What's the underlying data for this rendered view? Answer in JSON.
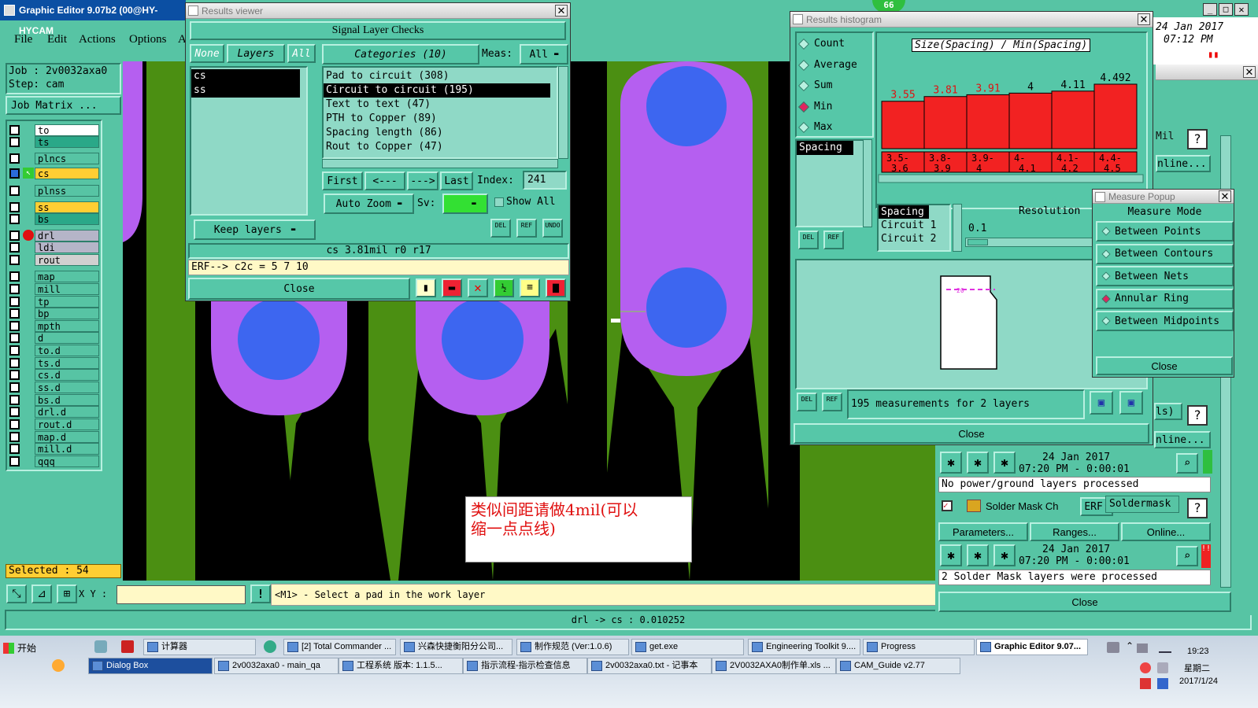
{
  "main": {
    "title": "Graphic Editor 9.07b2 (00@HY-HYCAM",
    "menu": [
      "File",
      "Edit",
      "Actions",
      "Options",
      "A"
    ],
    "job_label": "Job : 2v0032axa0",
    "step_label": "Step: cam",
    "job_matrix": "Job Matrix ...",
    "layers": [
      "to",
      "ts",
      "plncs",
      "cs",
      "plnss",
      "ss",
      "bs",
      "drl",
      "ldi",
      "rout",
      "map",
      "mill",
      "tp",
      "bp",
      "mpth",
      "d",
      "to.d",
      "ts.d",
      "cs.d",
      "ss.d",
      "bs.d",
      "drl.d",
      "rout.d",
      "map.d",
      "mill.d",
      "qqq"
    ],
    "selected": "Selected : 54",
    "xy_label": "X Y :",
    "prompt": "<M1> - Select a pad in the work layer",
    "status": "drl -> cs : 0.010252"
  },
  "results_viewer": {
    "title": "Results viewer",
    "header": "Signal Layer Checks",
    "none": "None",
    "layers_btn": "Layers",
    "all": "All",
    "categories": "Categories (10)",
    "meas": "Meas:",
    "meas_value": "All",
    "layer_list": [
      "cs",
      "ss"
    ],
    "category_list": [
      "Pad to circuit (308)",
      "Circuit to circuit (195)",
      "Text to text (47)",
      "PTH to Copper (89)",
      "Spacing length (86)",
      "Rout to Copper (47)"
    ],
    "first": "First",
    "prev": "<---",
    "next": "--->",
    "last": "Last",
    "index_label": "Index:",
    "index_value": "241",
    "keep_layers": "Keep layers",
    "auto_zoom": "Auto Zoom",
    "sv": "Sv:",
    "show_all": "Show All",
    "del": "DEL",
    "ref": "REF",
    "undo": "UNDO",
    "info_line": "cs 3.81mil  r0  r17",
    "erf_line": "ERF--> c2c = 5 7 10",
    "close": "Close"
  },
  "histogram": {
    "title": "Results histogram",
    "options": [
      "Count",
      "Average",
      "Sum",
      "Min",
      "Max"
    ],
    "selected_option": "Min",
    "chart_title": "Size(Spacing) / Min(Spacing)",
    "list_top": [
      "Spacing"
    ],
    "list_bottom": [
      "Spacing",
      "Circuit 1",
      "Circuit 2"
    ],
    "resolution_label": "Resolution",
    "resolution_value": "0.1",
    "summary": "195 measurements for 2 layers",
    "close": "Close"
  },
  "chart_data": {
    "type": "bar",
    "title": "Size(Spacing) / Min(Spacing)",
    "categories": [
      "3.5-3.6",
      "3.8-3.9",
      "3.9-4",
      "4-4.1",
      "4.1-4.2",
      "4.4-4.5"
    ],
    "values": [
      3.55,
      3.81,
      3.91,
      4,
      4.11,
      4.492
    ],
    "value_labels": [
      "3.55",
      "3.81",
      "3.91",
      "4",
      "4.11",
      "4.492"
    ],
    "bar_color": "#f22222"
  },
  "measure_popup": {
    "title": "Measure Popup",
    "header": "Measure Mode",
    "modes": [
      "Between Points",
      "Between Contours",
      "Between Nets",
      "Annular Ring",
      "Between Midpoints"
    ],
    "selected_mode": "Annular Ring",
    "close": "Close"
  },
  "right_panel": {
    "date_top": "24 Jan 2017",
    "time_top": "07:12 PM",
    "mil": "Mil",
    "online1": "nline...",
    "ls": "ls)",
    "online2": "nline...",
    "date1": "24 Jan 2017",
    "time1": "07:20 PM - 0:00:01",
    "msg1": "No power/ground layers processed",
    "solder_mask": "Solder Mask Ch",
    "erf": "ERF:",
    "soldermask": "Soldermask",
    "parameters": "Parameters...",
    "ranges": "Ranges...",
    "online3": "Online...",
    "date2": "24 Jan 2017",
    "time2": "07:20 PM - 0:00:01",
    "msg2": "2 Solder Mask layers were processed",
    "close": "Close"
  },
  "annotation": {
    "line1": "类似间距请做4mil(可以",
    "line2": "缩一点点线)"
  },
  "canvas": {
    "dim_label": "20"
  },
  "badge": "66",
  "taskbar": {
    "start": "开始",
    "row1": [
      "计算器",
      "[2] Total Commander ...",
      "兴森快捷衡阳分公司...",
      "制作规范 (Ver:1.0.6)",
      "get.exe",
      "Engineering Toolkit 9....",
      "Progress",
      "Graphic Editor 9.07..."
    ],
    "row2": [
      "Dialog Box",
      "2v0032axa0 - main_qa",
      "工程系统  版本: 1.1.5...",
      "指示流程-指示检查信息",
      "2v0032axa0.txt - 记事本",
      "2V0032AXA0制作单.xls ...",
      "CAM_Guide v2.77"
    ],
    "clock": "19:23",
    "weekday": "星期二",
    "date": "2017/1/24"
  }
}
